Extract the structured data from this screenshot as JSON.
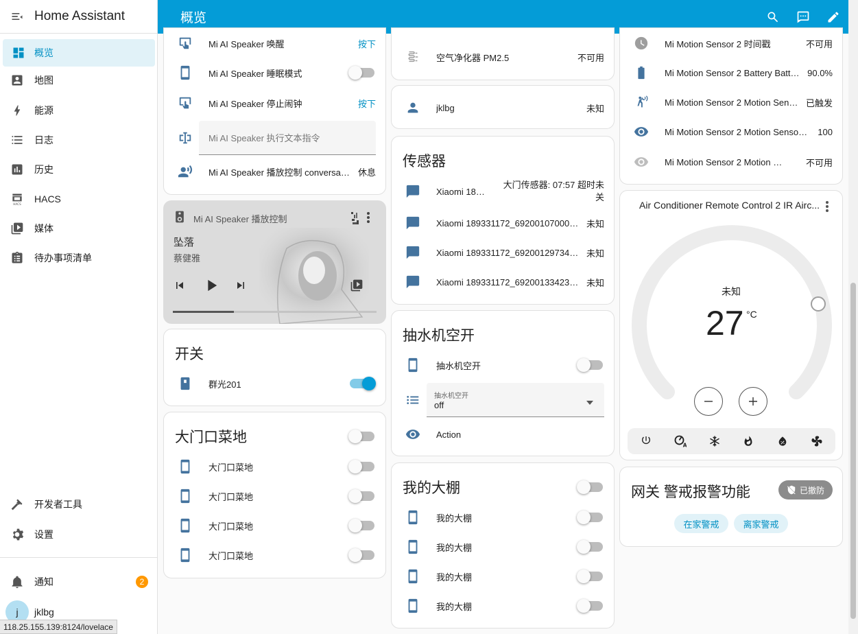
{
  "app_title": "Home Assistant",
  "page_title": "概览",
  "status_url": "118.25.155.139:8124/lovelace",
  "nav": {
    "items": [
      {
        "label": "概览"
      },
      {
        "label": "地图"
      },
      {
        "label": "能源"
      },
      {
        "label": "日志"
      },
      {
        "label": "历史"
      },
      {
        "label": "HACS"
      },
      {
        "label": "媒体"
      },
      {
        "label": "待办事项清单"
      }
    ],
    "dev_tools": "开发者工具",
    "settings": "设置",
    "notifications": "通知",
    "notification_count": "2",
    "user": "jklbg",
    "user_initial": "j"
  },
  "col1": {
    "speaker_rows": [
      {
        "name": "Mi AI Speaker 唤醒",
        "state": "按下"
      },
      {
        "name": "Mi AI Speaker 睡眠模式"
      },
      {
        "name": "Mi AI Speaker 停止闹钟",
        "state": "按下"
      },
      {
        "placeholder": "Mi AI Speaker 执行文本指令"
      },
      {
        "name": "Mi AI Speaker 播放控制 conversation",
        "state": "休息"
      }
    ],
    "media": {
      "title": "Mi AI Speaker 播放控制",
      "song": "坠落",
      "artist": "蔡健雅",
      "progress": 0.3
    },
    "switch_card": {
      "title": "开关",
      "row": "群光201"
    },
    "garden_card": {
      "title": "大门口菜地",
      "rows": [
        "大门口菜地",
        "大门口菜地",
        "大门口菜地",
        "大门口菜地"
      ]
    }
  },
  "col2": {
    "pm25": {
      "name": "空气净化器 PM2.5",
      "state": "不可用"
    },
    "person": {
      "name": "jklbg",
      "state": "未知"
    },
    "sensors": {
      "title": "传感器",
      "rows": [
        {
          "name": "Xiaomi 18933...",
          "state": "大门传感器: 07:57 超时未关"
        },
        {
          "name": "Xiaomi 189331172_692001070009 ...",
          "state": "未知"
        },
        {
          "name": "Xiaomi 189331172_692001297345 ...",
          "state": "未知"
        },
        {
          "name": "Xiaomi 189331172_692001334231 ...",
          "state": "未知"
        }
      ]
    },
    "pump": {
      "title": "抽水机空开",
      "switch": "抽水机空开",
      "select_label": "抽水机空开",
      "select_value": "off",
      "action": "Action"
    },
    "greenhouse": {
      "title": "我的大棚",
      "rows": [
        "我的大棚",
        "我的大棚",
        "我的大棚",
        "我的大棚"
      ]
    }
  },
  "col3": {
    "motion_rows": [
      {
        "name": "Mi Motion Sensor 2 时间戳",
        "state": "不可用"
      },
      {
        "name": "Mi Motion Sensor 2 Battery Batter...",
        "state": "90.0%"
      },
      {
        "name": "Mi Motion Sensor 2 Motion Sensor",
        "state": "已触发"
      },
      {
        "name": "Mi Motion Sensor 2 Motion Sensor Ill...",
        "state": "100"
      },
      {
        "name": "Mi Motion Sensor 2 Motion Senso...",
        "state": "不可用"
      }
    ],
    "thermostat": {
      "title": "Air Conditioner Remote Control 2 IR Airc...",
      "status": "未知",
      "temp": "27",
      "unit": "°C",
      "modes": [
        "power-icon",
        "auto-icon",
        "cool-icon",
        "heat-icon",
        "dry-icon",
        "fan-icon"
      ]
    },
    "alarm": {
      "title": "网关 警戒报警功能",
      "badge": "已撤防",
      "home": "在家警戒",
      "away": "离家警戒"
    }
  }
}
